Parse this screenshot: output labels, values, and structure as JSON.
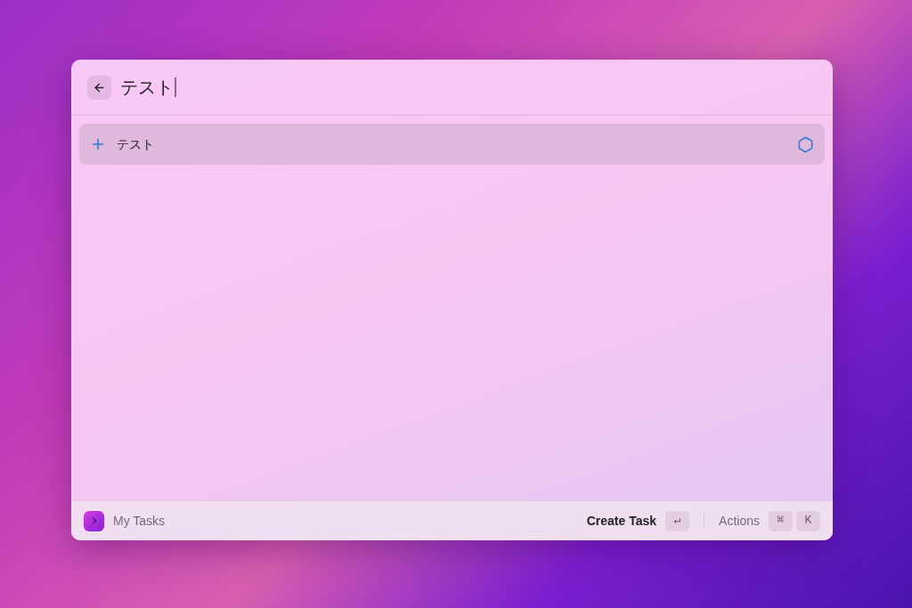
{
  "search": {
    "value": "テスト"
  },
  "results": [
    {
      "label": "テスト",
      "selected": true
    }
  ],
  "footer": {
    "app": "My Tasks",
    "primary_action": "Create Task",
    "primary_keys": [
      "↵"
    ],
    "secondary_action": "Actions",
    "secondary_keys": [
      "⌘",
      "K"
    ]
  }
}
